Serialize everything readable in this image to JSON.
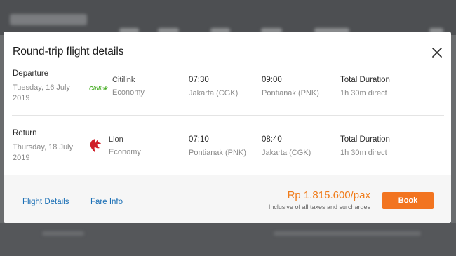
{
  "modal": {
    "title": "Round-trip flight details"
  },
  "departure": {
    "label": "Departure",
    "date": "Tuesday, 16 July 2019",
    "airline": "Citilink",
    "logo_text": "Citilink",
    "class": "Economy",
    "dep_time": "07:30",
    "dep_place": "Jakarta (CGK)",
    "arr_time": "09:00",
    "arr_place": "Pontianak (PNK)",
    "duration_label": "Total Duration",
    "duration": "1h 30m direct"
  },
  "return": {
    "label": "Return",
    "date": "Thursday, 18 July 2019",
    "airline": "Lion",
    "class": "Economy",
    "dep_time": "07:10",
    "dep_place": "Pontianak (PNK)",
    "arr_time": "08:40",
    "arr_place": "Jakarta (CGK)",
    "duration_label": "Total Duration",
    "duration": "1h 30m direct"
  },
  "footer": {
    "flight_details_link": "Flight Details",
    "fare_info_link": "Fare Info",
    "price": "Rp 1.815.600/pax",
    "price_note": "Inclusive of all taxes and surcharges",
    "book_label": "Book"
  },
  "colors": {
    "accent": "#f27420",
    "link": "#1a6fb5",
    "citilink_green": "#4caf2a",
    "lion_red": "#d0202a"
  }
}
